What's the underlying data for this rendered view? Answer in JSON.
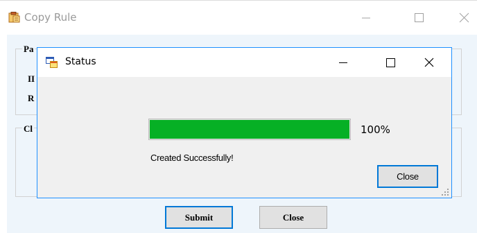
{
  "parent_window": {
    "title": "Copy Rule",
    "title_icon": "clipboard-icon",
    "controls": [
      "minimize-icon",
      "maximize-icon",
      "close-icon"
    ],
    "group1_label": "Pa",
    "field_id_label": "II",
    "field_r_label": "R",
    "group2_label": "Cl",
    "submit_label": "Submit",
    "close_label": "Close"
  },
  "status_dialog": {
    "title": "Status",
    "title_icon": "app-window-icon",
    "controls": [
      "minimize-icon",
      "maximize-icon",
      "close-icon"
    ],
    "progress_percent": 100,
    "progress_label": "100%",
    "message": "Created Successfully!",
    "close_label": "Close"
  },
  "colors": {
    "progress_fill": "#06b025",
    "focus_border": "#0078d7",
    "client_background": "#eef5fb"
  }
}
